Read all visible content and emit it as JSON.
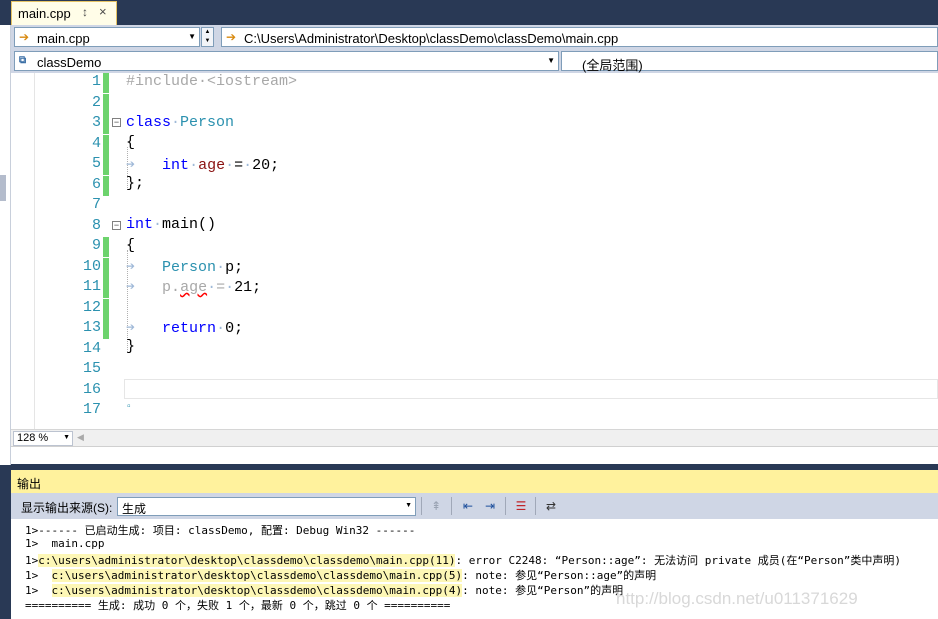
{
  "tab": {
    "label": "main.cpp",
    "pin_glyph": "↕",
    "close_glyph": "×"
  },
  "nav": {
    "file_combo": "main.cpp",
    "path": "C:\\Users\\Administrator\\Desktop\\classDemo\\classDemo\\main.cpp",
    "project_combo": "classDemo",
    "scope_combo": "(全局范围)"
  },
  "editor": {
    "line_numbers": [
      "1",
      "2",
      "3",
      "4",
      "5",
      "6",
      "7",
      "8",
      "9",
      "10",
      "11",
      "12",
      "13",
      "14",
      "15",
      "16",
      "17"
    ],
    "changed_lines": [
      1,
      2,
      3,
      4,
      5,
      6,
      9,
      10,
      11,
      12,
      13
    ],
    "fold_symbol": "−"
  },
  "zoom": {
    "value": "128 %"
  },
  "output": {
    "title": "输出",
    "source_label": "显示输出来源(S):",
    "source_value": "生成",
    "lines": [
      "1>------ 已启动生成: 项目: classDemo, 配置: Debug Win32 ------",
      "1>  main.cpp",
      "1>c:\\users\\administrator\\desktop\\classdemo\\classdemo\\main.cpp(11): error C2248: “Person::age”: 无法访问 private 成员(在“Person”类中声明)",
      "1>  c:\\users\\administrator\\desktop\\classdemo\\classdemo\\main.cpp(5): note: 参见“Person::age”的声明",
      "1>  c:\\users\\administrator\\desktop\\classdemo\\classdemo\\main.cpp(4): note: 参见“Person”的声明",
      "========== 生成: 成功 0 个，失败 1 个，最新 0 个，跳过 0 个 =========="
    ]
  },
  "watermark": "http://blog.csdn.net/u011371629",
  "colors": {
    "accent": "#293955",
    "output_title": "#fff29d",
    "change_bar": "#6dd36d",
    "keyword": "#0000ff",
    "type": "#2b91af"
  }
}
